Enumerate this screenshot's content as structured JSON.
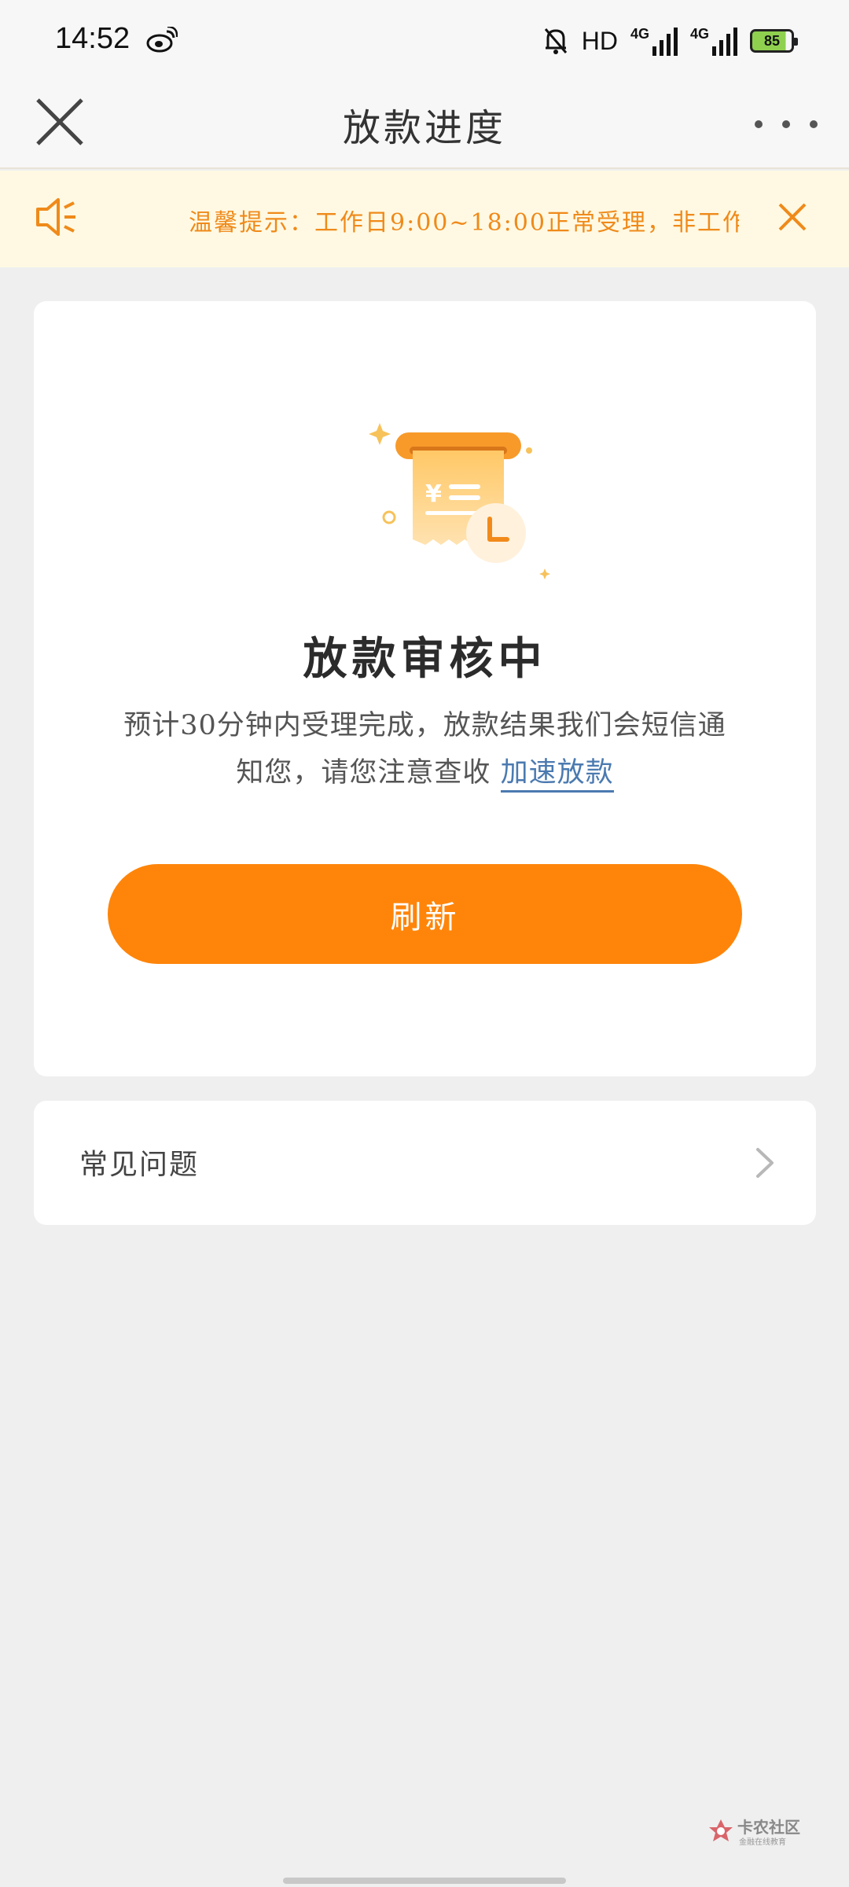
{
  "status_bar": {
    "time": "14:52",
    "hd_label": "HD",
    "network_1": "4G",
    "network_2": "4G",
    "battery": "85"
  },
  "nav": {
    "title": "放款进度"
  },
  "notice": {
    "text": "温馨提示：工作日9:00~18:00正常受理，非工作"
  },
  "review": {
    "title": "放款审核中",
    "description_line1": "预计30分钟内受理完成，放款结果我们会短信通",
    "description_line2": "知您，请您注意查收",
    "speed_link": "加速放款",
    "refresh_button": "刷新"
  },
  "faq": {
    "label": "常见问题"
  },
  "watermark": {
    "title": "卡农社区",
    "subtitle": "金融在线教育"
  },
  "colors": {
    "accent": "#fe850a",
    "notice_text": "#ef8a1a",
    "notice_bg": "#fff9e3",
    "link": "#4b7ab0"
  }
}
